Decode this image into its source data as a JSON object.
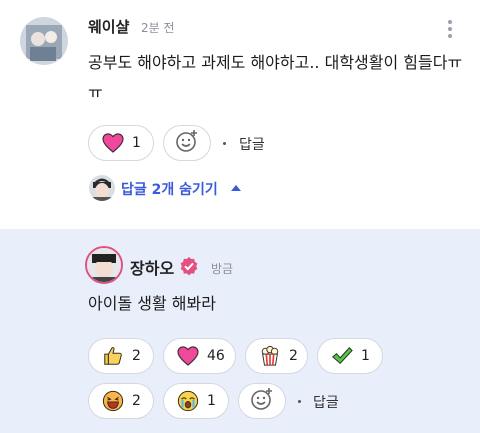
{
  "comment": {
    "author": "웨이샬",
    "time": "2분 전",
    "text": "공부도 해야하고 과제도 해야하고.. 대학생활이 힘들다ㅠㅠ",
    "reactions": [
      {
        "icon": "heart-icon",
        "count": "1"
      }
    ],
    "reply_label": "답글",
    "toggle_label": "답글 2개 숨기기"
  },
  "reply": {
    "author": "장하오",
    "time": "방금",
    "text": "아이돌 생활 해봐라",
    "reactions": [
      {
        "icon": "thumbs-up-icon",
        "count": "2"
      },
      {
        "icon": "heart-icon",
        "count": "46"
      },
      {
        "icon": "popcorn-icon",
        "count": "2"
      },
      {
        "icon": "checkmark-icon",
        "count": "1"
      },
      {
        "icon": "laughing-face-icon",
        "count": "2"
      },
      {
        "icon": "crying-face-icon",
        "count": "1"
      }
    ],
    "reply_label": "답글"
  },
  "colors": {
    "accent": "#3a5bd9",
    "verified": "#e2517f",
    "heart": "#f0489b",
    "reply_bg": "#e9eefb"
  }
}
